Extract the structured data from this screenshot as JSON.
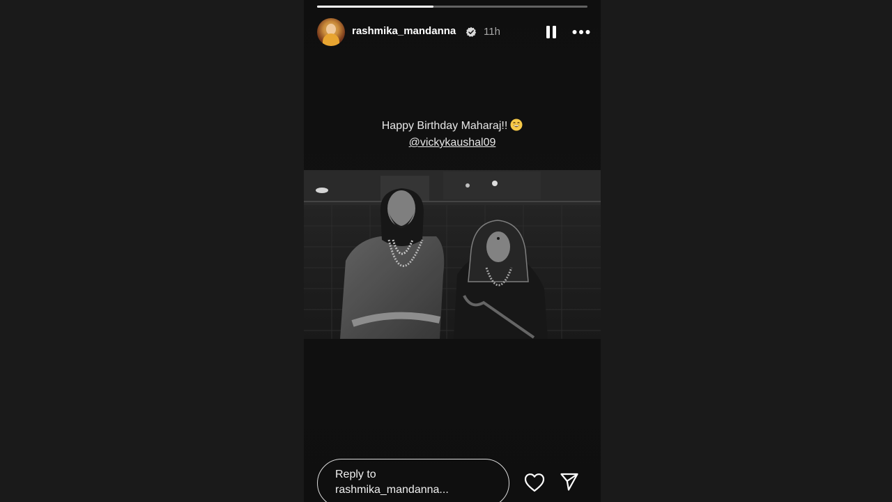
{
  "story": {
    "progress": 0.43,
    "username": "rashmika_mandanna",
    "time_ago": "11h",
    "verified": true,
    "caption_line1": "Happy Birthday Maharaj!!",
    "caption_emoji": "grinning-face-emoji",
    "caption_mention": "@vickykaushal09",
    "photo": "black-and-white photo of a bearded man in traditional attire and a smiling woman in a saree"
  },
  "reply": {
    "placeholder_line1": "Reply to",
    "placeholder_line2": "rashmika_mandanna..."
  },
  "icons": {
    "verified": "verified-badge-icon",
    "pause": "pause-icon",
    "more": "more-options-icon",
    "like": "heart-icon",
    "send": "send-icon"
  },
  "colors": {
    "background": "#1a1a1a",
    "story_background": "#0f0f0f",
    "text": "#ffffff",
    "muted": "#a8a8a8"
  }
}
